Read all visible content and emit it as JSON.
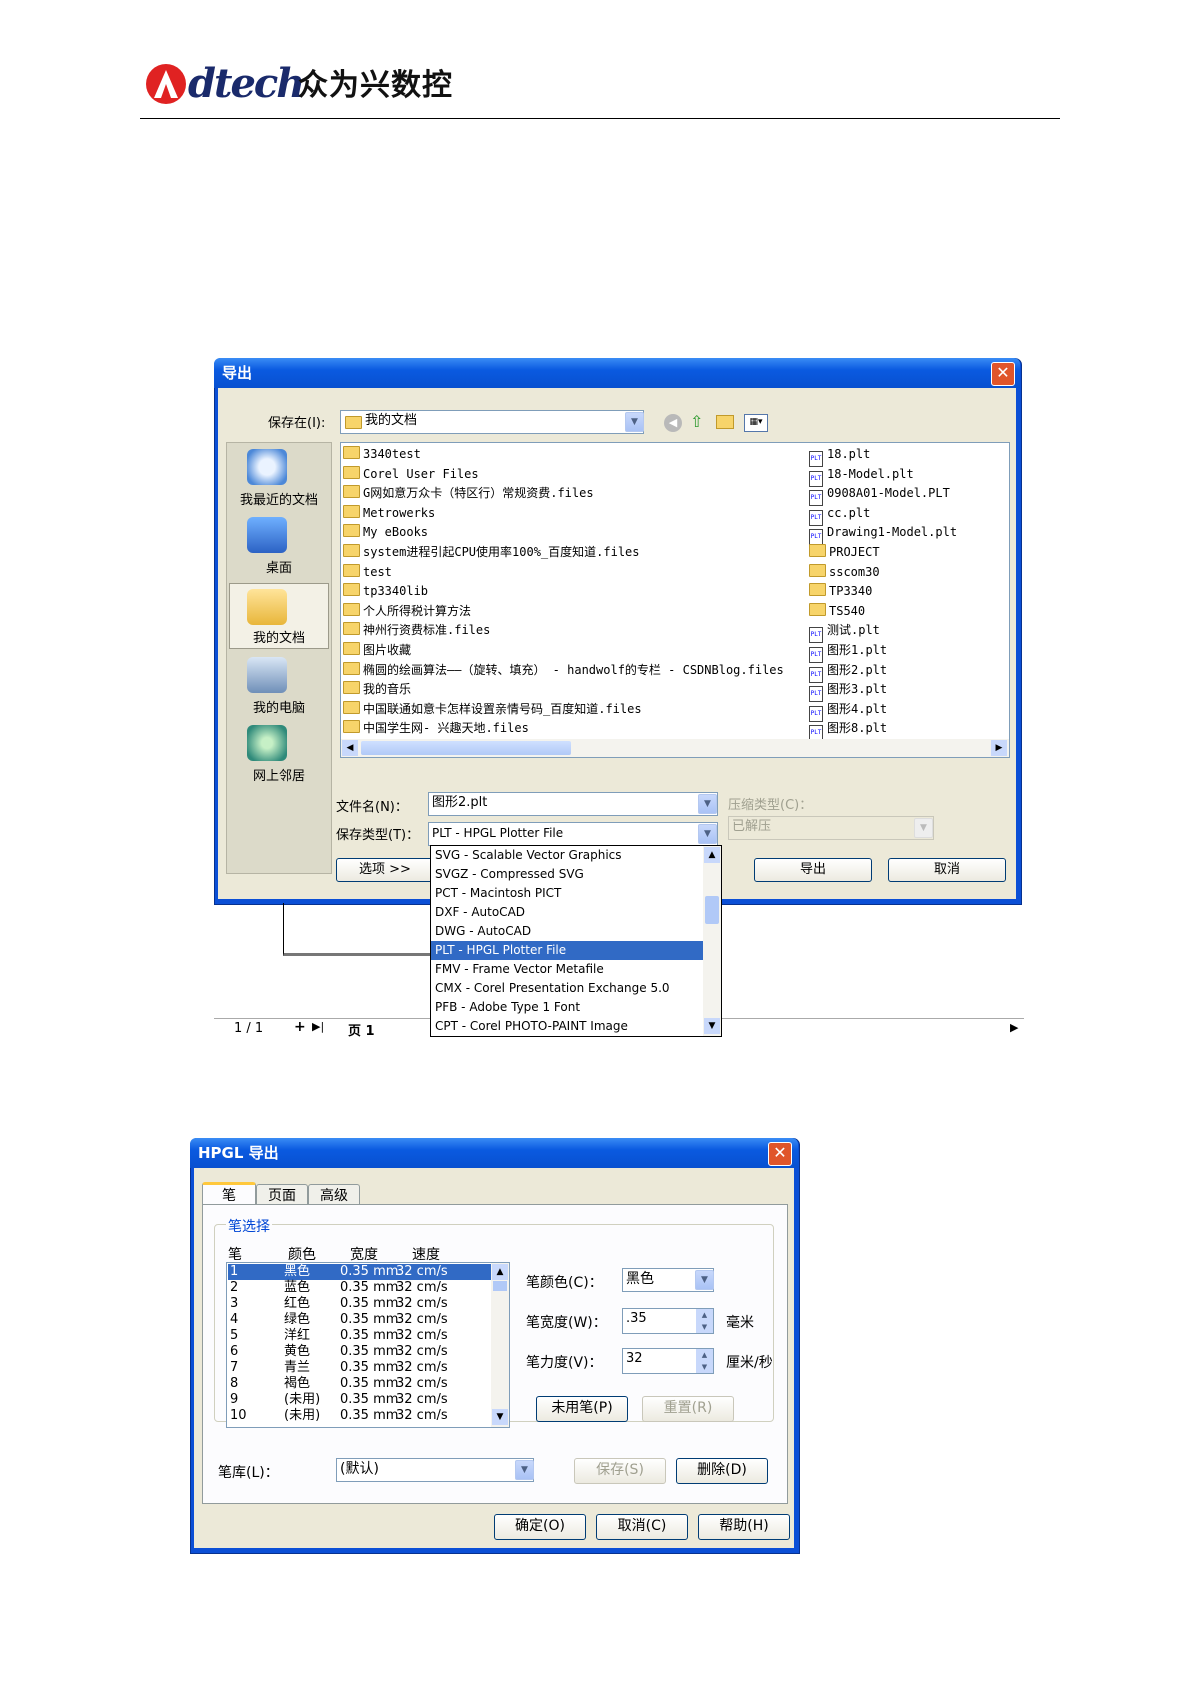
{
  "header": {
    "logo_word": "dtech",
    "logo_cn": "众为兴数控"
  },
  "export_dialog": {
    "title": "导出",
    "save_in_label": "保存在(I):",
    "save_in_value": "我的文档",
    "nav": [
      "我最近的文档",
      "桌面",
      "我的文档",
      "我的电脑",
      "网上邻居"
    ],
    "files_left": [
      "3340test",
      "Corel User Files",
      "G网如意万众卡（特区行）常规资费.files",
      "Metrowerks",
      "My eBooks",
      "system进程引起CPU使用率100%_百度知道.files",
      "test",
      "tp3340lib",
      "个人所得税计算方法",
      "神州行资费标准.files",
      "图片收藏",
      "椭圆的绘画算法——（旋转、填充） - handwolf的专栏 - CSDNBlog.files",
      "我的音乐",
      "中国联通如意卡怎样设置亲情号码_百度知道.files",
      "中国学生网- 兴趣天地.files"
    ],
    "files_right": [
      "18.plt",
      "18-Model.plt",
      "0908A01-Model.PLT",
      "cc.plt",
      "Drawing1-Model.plt",
      "PROJECT",
      "sscom30",
      "TP3340",
      "TS540",
      "测试.plt",
      "图形1.plt",
      "图形2.plt",
      "图形3.plt",
      "图形4.plt",
      "图形8.plt"
    ],
    "filename_label": "文件名(N)：",
    "filename_value": "图形2.plt",
    "filetype_label": "保存类型(T)：",
    "filetype_value": "PLT - HPGL Plotter File",
    "compress_label": "压缩类型(C)：",
    "compress_value": "已解压",
    "options_button": "选项 >>",
    "export_button": "导出",
    "cancel_button": "取消",
    "type_options": [
      "SVG - Scalable Vector Graphics",
      "SVGZ - Compressed SVG",
      "PCT - Macintosh PICT",
      "DXF - AutoCAD",
      "DWG - AutoCAD",
      "PLT - HPGL Plotter File",
      "FMV - Frame Vector Metafile",
      "CMX - Corel Presentation Exchange 5.0",
      "PFB - Adobe Type 1 Font",
      "CPT - Corel PHOTO-PAINT Image"
    ],
    "page_counter": "1 / 1",
    "page_tab": "页 1"
  },
  "hpgl_dialog": {
    "title": "HPGL 导出",
    "tabs": [
      "笔",
      "页面",
      "高级"
    ],
    "group_label": "笔选择",
    "columns": [
      "笔",
      "颜色",
      "宽度",
      "速度"
    ],
    "pens": [
      {
        "n": "1",
        "color": "黑色",
        "width": "0.35 mm",
        "speed": "32 cm/s"
      },
      {
        "n": "2",
        "color": "蓝色",
        "width": "0.35 mm",
        "speed": "32 cm/s"
      },
      {
        "n": "3",
        "color": "红色",
        "width": "0.35 mm",
        "speed": "32 cm/s"
      },
      {
        "n": "4",
        "color": "绿色",
        "width": "0.35 mm",
        "speed": "32 cm/s"
      },
      {
        "n": "5",
        "color": "洋红",
        "width": "0.35 mm",
        "speed": "32 cm/s"
      },
      {
        "n": "6",
        "color": "黄色",
        "width": "0.35 mm",
        "speed": "32 cm/s"
      },
      {
        "n": "7",
        "color": "青兰",
        "width": "0.35 mm",
        "speed": "32 cm/s"
      },
      {
        "n": "8",
        "color": "褐色",
        "width": "0.35 mm",
        "speed": "32 cm/s"
      },
      {
        "n": "9",
        "color": "(未用)",
        "width": "0.35 mm",
        "speed": "32 cm/s"
      },
      {
        "n": "10",
        "color": "(未用)",
        "width": "0.35 mm",
        "speed": "32 cm/s"
      }
    ],
    "pen_color_label": "笔颜色(C)：",
    "pen_color_value": "黑色",
    "pen_width_label": "笔宽度(W)：",
    "pen_width_value": ".35",
    "pen_width_unit": "毫米",
    "pen_force_label": "笔力度(V)：",
    "pen_force_value": "32",
    "pen_force_unit": "厘米/秒",
    "unused_button": "未用笔(P)",
    "reset_button": "重置(R)",
    "library_label": "笔库(L)：",
    "library_value": "(默认)",
    "save_button": "保存(S)",
    "delete_button": "删除(D)",
    "ok_button": "确定(O)",
    "cancel_button": "取消(C)",
    "help_button": "帮助(H)"
  }
}
